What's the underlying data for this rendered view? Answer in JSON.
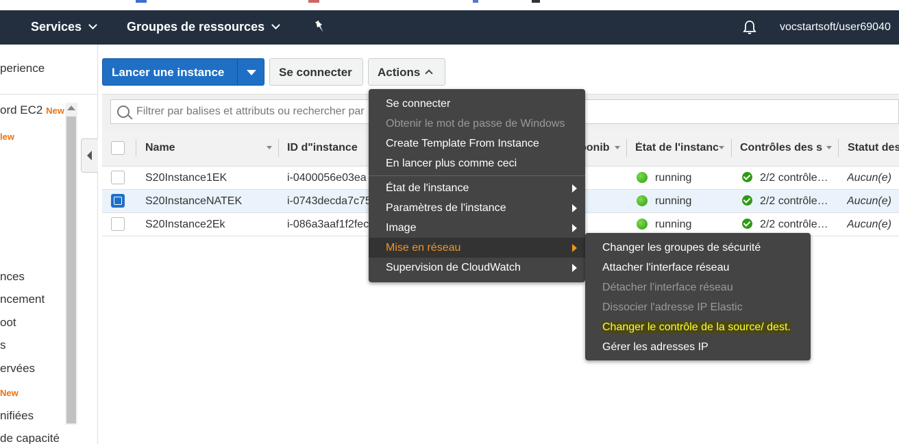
{
  "nav": {
    "services": "Services",
    "resource_groups": "Groupes de ressources",
    "user": "vocstartsoft/user69040"
  },
  "sidebar": {
    "items": [
      {
        "label": "perience"
      },
      {
        "label": "ord EC2",
        "badge": "New"
      },
      {
        "label": "",
        "badge": "lew"
      },
      {
        "label": "nces"
      },
      {
        "label": "ncement"
      },
      {
        "label": "oot"
      },
      {
        "label": "s"
      },
      {
        "label": "ervées"
      },
      {
        "label": "",
        "badge": "New"
      },
      {
        "label": "nifiées"
      },
      {
        "label": "de capacité"
      }
    ]
  },
  "toolbar": {
    "launch": "Lancer une instance",
    "connect": "Se connecter",
    "actions": "Actions"
  },
  "filter": {
    "placeholder": "Filtrer par balises et attributs ou rechercher par"
  },
  "table": {
    "headers": {
      "name": "Name",
      "id": "ID d\"instance",
      "az": "ponib",
      "state": "État de l'instanc",
      "checks": "Contrôles des s",
      "alarm": "Statut des"
    },
    "rows": [
      {
        "name": "S20Instance1EK",
        "id": "i-0400056e03ea",
        "state": "running",
        "checks": "2/2 contrôle…",
        "alarm": "Aucun(e)",
        "selected": false
      },
      {
        "name": "S20InstanceNATEK",
        "id": "i-0743decda7c75",
        "state": "running",
        "checks": "2/2 contrôle…",
        "alarm": "Aucun(e)",
        "selected": true
      },
      {
        "name": "S20Instance2Ek",
        "id": "i-086a3aaf1f2fec",
        "state": "running",
        "checks": "2/2 contrôle…",
        "alarm": "Aucun(e)",
        "selected": false
      }
    ]
  },
  "actions_menu": {
    "items": [
      {
        "label": "Se connecter",
        "disabled": false
      },
      {
        "label": "Obtenir le mot de passe de Windows",
        "disabled": true
      },
      {
        "label": "Create Template From Instance",
        "disabled": false
      },
      {
        "label": "En lancer plus comme ceci",
        "disabled": false
      },
      {
        "label": "État de l'instance",
        "submenu": true
      },
      {
        "label": "Paramètres de l'instance",
        "submenu": true
      },
      {
        "label": "Image",
        "submenu": true
      },
      {
        "label": "Mise en réseau",
        "submenu": true,
        "active": true
      },
      {
        "label": "Supervision de CloudWatch",
        "submenu": true
      }
    ]
  },
  "network_submenu": {
    "items": [
      {
        "label": "Changer les groupes de sécurité",
        "disabled": false
      },
      {
        "label": "Attacher l'interface réseau",
        "disabled": false
      },
      {
        "label": "Détacher l'interface réseau",
        "disabled": true
      },
      {
        "label": "Dissocier l'adresse IP Elastic",
        "disabled": true
      },
      {
        "label": "Changer le contrôle de la source/ dest.",
        "disabled": false,
        "highlighted": true
      },
      {
        "label": "Gérer les adresses IP",
        "disabled": false
      }
    ]
  },
  "colors": {
    "nav_bg": "#232f3e",
    "primary": "#1f6fc5",
    "new_badge": "#ec7211",
    "menu_bg": "#444444",
    "menu_active": "#f7931e",
    "highlight_text": "#ffff33"
  }
}
